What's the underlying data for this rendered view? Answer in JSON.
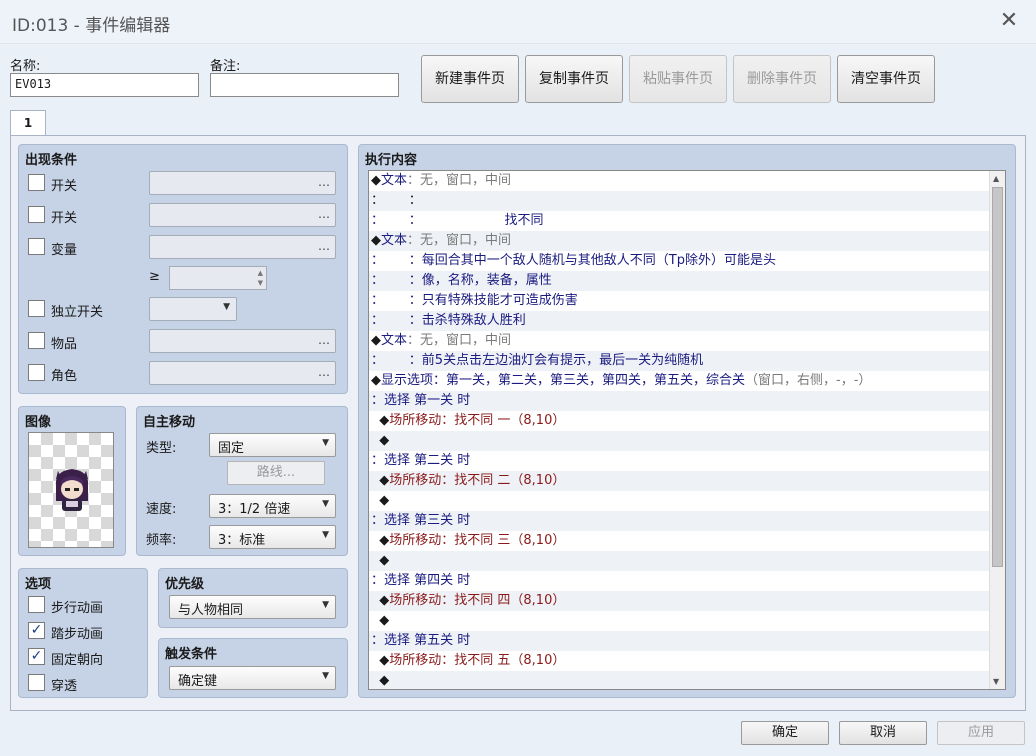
{
  "window": {
    "title": "ID:013 - 事件编辑器",
    "close": "✕"
  },
  "name_label": "名称:",
  "name_value": "EV013",
  "note_label": "备注:",
  "note_value": "",
  "toolbar": {
    "new_page": "新建事件页",
    "copy_page": "复制事件页",
    "paste_page": "粘贴事件页",
    "delete_page": "删除事件页",
    "clear_page": "清空事件页"
  },
  "tab": {
    "label": "1"
  },
  "conditions": {
    "title": "出现条件",
    "switch1": "开关",
    "switch2": "开关",
    "variable": "变量",
    "geq": "≥",
    "self_switch": "独立开关",
    "item": "物品",
    "actor": "角色",
    "dots": "…"
  },
  "image": {
    "title": "图像"
  },
  "autonomous": {
    "title": "自主移动",
    "type_label": "类型:",
    "type_value": "固定",
    "route": "路线...",
    "speed_label": "速度:",
    "speed_value": "3：1/2 倍速",
    "freq_label": "频率:",
    "freq_value": "3：标准"
  },
  "options": {
    "title": "选项",
    "items": [
      {
        "label": "步行动画",
        "checked": false
      },
      {
        "label": "踏步动画",
        "checked": true
      },
      {
        "label": "固定朝向",
        "checked": true
      },
      {
        "label": "穿透",
        "checked": false
      }
    ]
  },
  "priority": {
    "title": "优先级",
    "value": "与人物相同"
  },
  "trigger": {
    "title": "触发条件",
    "value": "确定键"
  },
  "contents": {
    "title": "执行内容",
    "rows": [
      [
        {
          "t": "◆",
          "c": ""
        },
        {
          "t": "文本",
          "c": "kw"
        },
        {
          "t": "：无，窗口，中间",
          "c": "tx"
        }
      ],
      [
        {
          "t": "：      ：",
          "c": ""
        }
      ],
      [
        {
          "t": "：      ：                    找不同",
          "c": "kw"
        }
      ],
      [
        {
          "t": "◆",
          "c": ""
        },
        {
          "t": "文本",
          "c": "kw"
        },
        {
          "t": "：无，窗口，中间",
          "c": "tx"
        }
      ],
      [
        {
          "t": "：      ：每回合其中一个敌人随机与其他敌人不同（Tp除外）可能是头",
          "c": "kw"
        }
      ],
      [
        {
          "t": "：      ：像，名称，装备，属性",
          "c": "kw"
        }
      ],
      [
        {
          "t": "：      ：只有特殊技能才可造成伤害",
          "c": "kw"
        }
      ],
      [
        {
          "t": "：      ：击杀特殊敌人胜利",
          "c": "kw"
        }
      ],
      [
        {
          "t": "◆",
          "c": ""
        },
        {
          "t": "文本",
          "c": "kw"
        },
        {
          "t": "：无，窗口，中间",
          "c": "tx"
        }
      ],
      [
        {
          "t": "：      ：前5关点击左边油灯会有提示，最后一关为纯随机",
          "c": "kw"
        }
      ],
      [
        {
          "t": "◆",
          "c": ""
        },
        {
          "t": "显示选项：第一关，第二关，第三关，第四关，第五关，综合关",
          "c": "kw"
        },
        {
          "t": "（窗口，右侧，-，-）",
          "c": "tx"
        }
      ],
      [
        {
          "t": "：选择 第一关 时",
          "c": "kw"
        }
      ],
      [
        {
          "t": "  ◆",
          "c": ""
        },
        {
          "t": "场所移动：找不同 一（8,10）",
          "c": "mv"
        }
      ],
      [
        {
          "t": "  ◆",
          "c": ""
        }
      ],
      [
        {
          "t": "：选择 第二关 时",
          "c": "kw"
        }
      ],
      [
        {
          "t": "  ◆",
          "c": ""
        },
        {
          "t": "场所移动：找不同 二（8,10）",
          "c": "mv"
        }
      ],
      [
        {
          "t": "  ◆",
          "c": ""
        }
      ],
      [
        {
          "t": "：选择 第三关 时",
          "c": "kw"
        }
      ],
      [
        {
          "t": "  ◆",
          "c": ""
        },
        {
          "t": "场所移动：找不同 三（8,10）",
          "c": "mv"
        }
      ],
      [
        {
          "t": "  ◆",
          "c": ""
        }
      ],
      [
        {
          "t": "：选择 第四关 时",
          "c": "kw"
        }
      ],
      [
        {
          "t": "  ◆",
          "c": ""
        },
        {
          "t": "场所移动：找不同 四（8,10）",
          "c": "mv"
        }
      ],
      [
        {
          "t": "  ◆",
          "c": ""
        }
      ],
      [
        {
          "t": "：选择 第五关 时",
          "c": "kw"
        }
      ],
      [
        {
          "t": "  ◆",
          "c": ""
        },
        {
          "t": "场所移动：找不同 五（8,10）",
          "c": "mv"
        }
      ],
      [
        {
          "t": "  ◆",
          "c": ""
        }
      ]
    ]
  },
  "footer": {
    "ok": "确定",
    "cancel": "取消",
    "apply": "应用"
  }
}
